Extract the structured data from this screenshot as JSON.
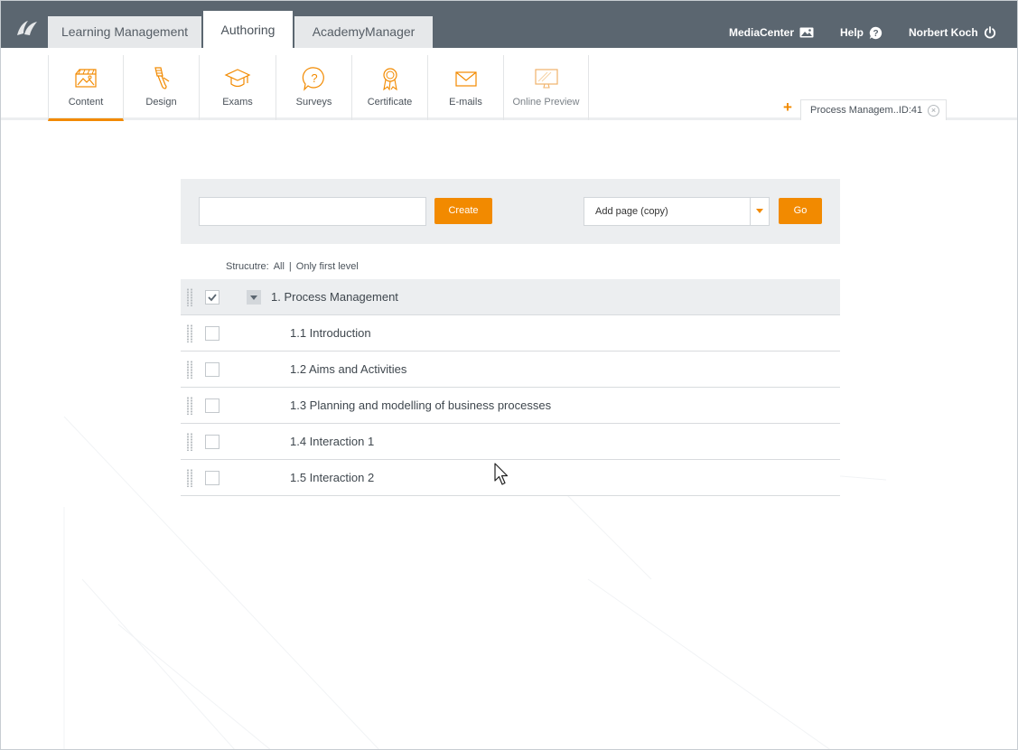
{
  "topbar": {
    "tabs": [
      {
        "label": "Learning Management",
        "active": false
      },
      {
        "label": "Authoring",
        "active": true
      },
      {
        "label": "AcademyManager",
        "active": false
      }
    ],
    "right": {
      "media_center": "MediaCenter",
      "help": "Help",
      "user": "Norbert Koch"
    }
  },
  "subnav": {
    "items": [
      {
        "label": "Content",
        "icon": "content-icon",
        "active": true
      },
      {
        "label": "Design",
        "icon": "paint-brush-icon",
        "active": false
      },
      {
        "label": "Exams",
        "icon": "graduation-cap-icon",
        "active": false
      },
      {
        "label": "Surveys",
        "icon": "question-bubble-icon",
        "active": false
      },
      {
        "label": "Certificate",
        "icon": "certificate-icon",
        "active": false
      },
      {
        "label": "E-mails",
        "icon": "envelope-icon",
        "active": false
      },
      {
        "label": "Online Preview",
        "icon": "monitor-icon",
        "active": false
      }
    ]
  },
  "doc_tab": {
    "add_symbol": "+",
    "label": "Process Managem..ID:41",
    "close_symbol": "×"
  },
  "toolbar": {
    "name_input_value": "",
    "create_label": "Create",
    "select_value": "Add page (copy)",
    "go_label": "Go"
  },
  "structure": {
    "label": "Strucutre:",
    "all": "All",
    "separator": "|",
    "first_level": "Only first level"
  },
  "tree": [
    {
      "label": "1. Process Management",
      "level": 1,
      "checked": true
    },
    {
      "label": "1.1 Introduction",
      "level": 2,
      "checked": false
    },
    {
      "label": "1.2 Aims and Activities",
      "level": 2,
      "checked": false
    },
    {
      "label": "1.3 Planning and modelling of business processes",
      "level": 2,
      "checked": false
    },
    {
      "label": "1.4 Interaction 1",
      "level": 2,
      "checked": false
    },
    {
      "label": "1.5 Interaction 2",
      "level": 2,
      "checked": false
    }
  ],
  "colors": {
    "accent": "#f28a00",
    "topbar": "#5b6670",
    "toolbar_bg": "#eceef0"
  }
}
